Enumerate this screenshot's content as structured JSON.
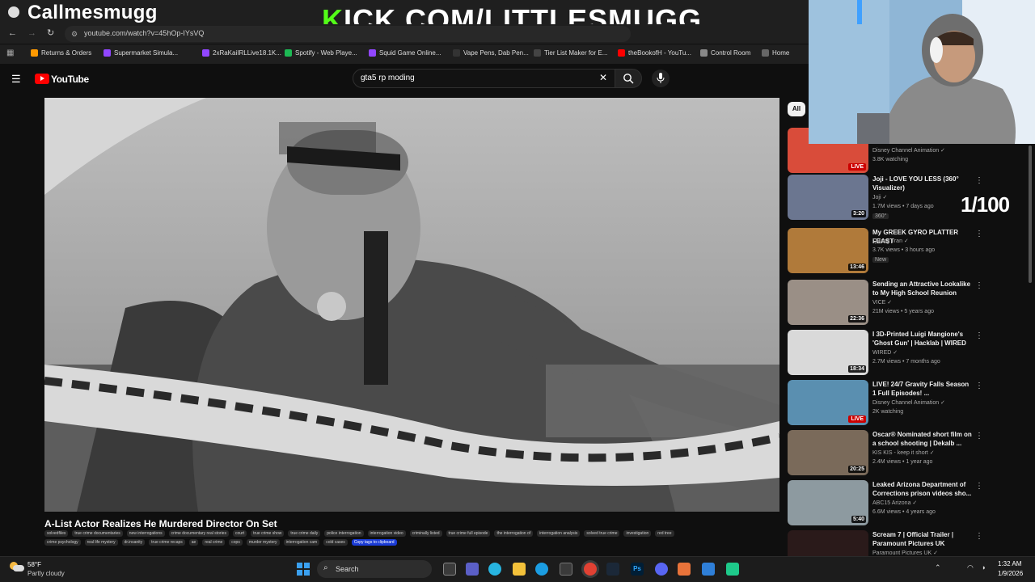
{
  "overlay": {
    "streamer_name": "Callmesmugg",
    "kick_prefix": "K",
    "kick_rest": "ICK.COM/LITTLESMUGG",
    "counter": "1/100"
  },
  "browser": {
    "url": "youtube.com/watch?v=45hOp-IYsVQ",
    "bookmarks": [
      {
        "label": "Returns & Orders",
        "color": "#ff9900"
      },
      {
        "label": "Supermarket Simula...",
        "color": "#9146ff"
      },
      {
        "label": "2xRaKaiIRLLive18.1K...",
        "color": "#9146ff"
      },
      {
        "label": "Spotify - Web Playe...",
        "color": "#1db954"
      },
      {
        "label": "Squid Game Online...",
        "color": "#9146ff"
      },
      {
        "label": "Vape Pens, Dab Pen...",
        "color": "#333333"
      },
      {
        "label": "Tier List Maker for E...",
        "color": "#444444"
      },
      {
        "label": "theBookofH - YouTu...",
        "color": "#ff0000"
      },
      {
        "label": "Control Room",
        "color": "#888888"
      },
      {
        "label": "Home",
        "color": "#666666"
      }
    ]
  },
  "youtube": {
    "logo_text": "YouTube",
    "search_query": "gta5 rp moding",
    "video_title": "A-List Actor Realizes He Murdered Director On Set",
    "tags_row1": [
      "solvedfiles",
      "true crime documentaries",
      "new interrogations",
      "crime documentary real stories",
      "court",
      "true crime show",
      "true crime daily",
      "police interrogation",
      "interrogation video",
      "criminally listed",
      "true crime full episode",
      "the interrogation of",
      "interrogation analysis",
      "solved true crime",
      "investigation",
      "red tree"
    ],
    "tags_row2": [
      "crime psychology",
      "real life mystery",
      "dr.insanity",
      "true crime recaps",
      "ae",
      "real crime",
      "cops",
      "murder mystery",
      "interrogation cam",
      "cold cases"
    ],
    "copy_tags": "Copy tags to clipboard",
    "filter_chip": "All",
    "recommended": [
      {
        "title": "",
        "channel": "Disney Channel Animation",
        "meta": "3.8K watching",
        "badge": "LIVE",
        "badge_type": "live",
        "thumb": "#d94c3a"
      },
      {
        "title": "Joji - LOVE YOU LESS (360° Visualizer)",
        "channel": "Joji",
        "meta": "1.7M views • 7 days ago",
        "badge": "3:20",
        "badge_type": "dur",
        "thumb": "#6b7690",
        "extra": "360°"
      },
      {
        "title": "My GREEK GYRO PLATTER FEAST",
        "channel": "Quang Tran",
        "meta": "3.7K views • 3 hours ago",
        "badge": "13:46",
        "badge_type": "dur",
        "thumb": "#b07a3a",
        "extra": "New"
      },
      {
        "title": "Sending an Attractive Lookalike to My High School Reunion",
        "channel": "VICE",
        "meta": "21M views • 5 years ago",
        "badge": "22:36",
        "badge_type": "dur",
        "thumb": "#9a8f86"
      },
      {
        "title": "I 3D-Printed Luigi Mangione's 'Ghost Gun' | Hacklab | WIRED",
        "channel": "WIRED",
        "meta": "2.7M views • 7 months ago",
        "badge": "18:34",
        "badge_type": "dur",
        "thumb": "#d9d9d9"
      },
      {
        "title": "LIVE! 24/7 Gravity Falls Season 1 Full Episodes! ...",
        "channel": "Disney Channel Animation",
        "meta": "2K watching",
        "badge": "LIVE",
        "badge_type": "live",
        "thumb": "#5a8fb0"
      },
      {
        "title": "Oscar® Nominated short film on a school shooting | Dekalb ...",
        "channel": "KIS KIS - keep it short",
        "meta": "2.4M views • 1 year ago",
        "badge": "20:25",
        "badge_type": "dur",
        "thumb": "#7a6a5a"
      },
      {
        "title": "Leaked Arizona Department of Corrections prison videos sho...",
        "channel": "ABC15 Arizona",
        "meta": "6.6M views • 4 years ago",
        "badge": "5:40",
        "badge_type": "dur",
        "thumb": "#8d9aa0"
      },
      {
        "title": "Scream 7 | Official Trailer | Paramount Pictures UK",
        "channel": "Paramount Pictures UK",
        "meta": "",
        "badge": "",
        "badge_type": "none",
        "thumb": "#2a1a1a"
      }
    ]
  },
  "taskbar": {
    "weather_temp": "58°F",
    "weather_desc": "Partly cloudy",
    "search_label": "Search",
    "time": "1:32 AM",
    "date": "1/9/2026"
  }
}
